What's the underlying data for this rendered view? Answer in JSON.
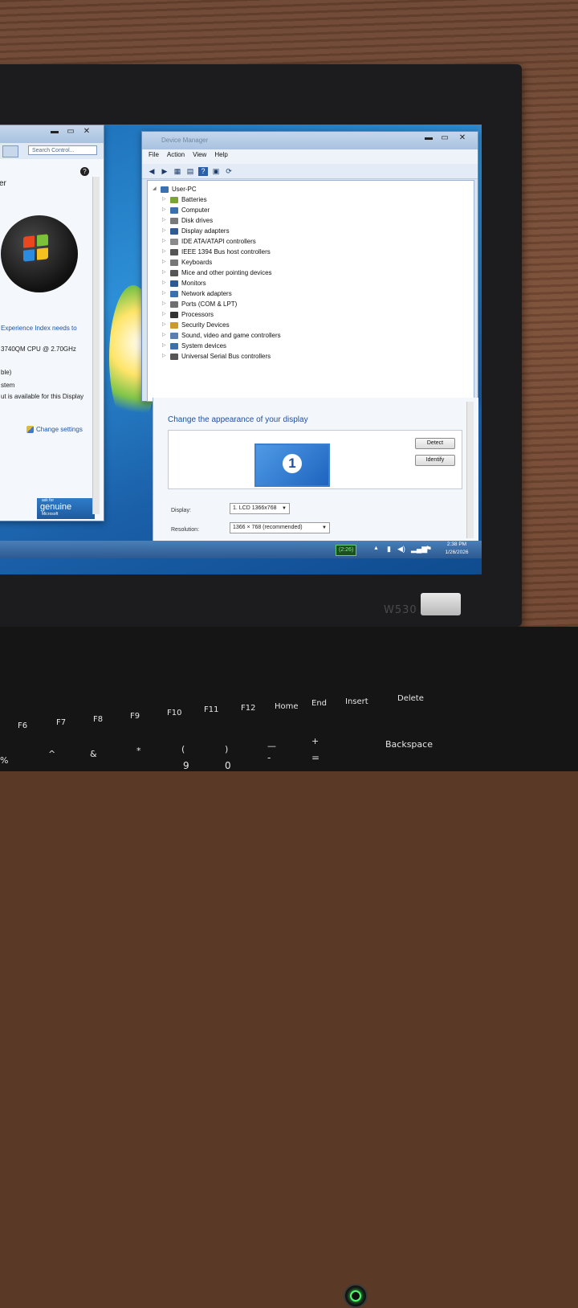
{
  "control_panel": {
    "search_placeholder": "Search Control...",
    "heading_partial": "er",
    "experience_text": "Experience Index needs to",
    "cpu_text": "3740QM CPU @ 2.70GHz",
    "line_able": "ble)",
    "line_stem": "stem",
    "display_note": "ut is available for this Display",
    "change_settings": "Change settings",
    "genuine_top": "ask for",
    "genuine": "genuine",
    "genuine_bottom": "Microsoft",
    "help_glyph": "?"
  },
  "device_manager": {
    "title": "Device Manager",
    "menu": [
      "File",
      "Action",
      "View",
      "Help"
    ],
    "root": "User-PC",
    "devices": [
      {
        "label": "Batteries",
        "icon": "battery-icon",
        "color": "#7aa33a"
      },
      {
        "label": "Computer",
        "icon": "computer-icon",
        "color": "#3a6fb0"
      },
      {
        "label": "Disk drives",
        "icon": "disk-icon",
        "color": "#7a7a7a"
      },
      {
        "label": "Display adapters",
        "icon": "display-adapter-icon",
        "color": "#2f5b95"
      },
      {
        "label": "IDE ATA/ATAPI controllers",
        "icon": "ide-icon",
        "color": "#8a8a8a"
      },
      {
        "label": "IEEE 1394 Bus host controllers",
        "icon": "firewire-icon",
        "color": "#555555"
      },
      {
        "label": "Keyboards",
        "icon": "keyboard-icon",
        "color": "#777777"
      },
      {
        "label": "Mice and other pointing devices",
        "icon": "mouse-icon",
        "color": "#555555"
      },
      {
        "label": "Monitors",
        "icon": "monitor-icon",
        "color": "#2f5b95"
      },
      {
        "label": "Network adapters",
        "icon": "network-icon",
        "color": "#3a6fb0"
      },
      {
        "label": "Ports (COM & LPT)",
        "icon": "port-icon",
        "color": "#6f6f6f"
      },
      {
        "label": "Processors",
        "icon": "processor-icon",
        "color": "#333333"
      },
      {
        "label": "Security Devices",
        "icon": "security-icon",
        "color": "#c99a2e"
      },
      {
        "label": "Sound, video and game controllers",
        "icon": "sound-icon",
        "color": "#5a7fb0"
      },
      {
        "label": "System devices",
        "icon": "system-icon",
        "color": "#3a6fb0"
      },
      {
        "label": "Universal Serial Bus controllers",
        "icon": "usb-icon",
        "color": "#555555"
      }
    ]
  },
  "display_settings": {
    "heading": "Change the appearance of your display",
    "detect": "Detect",
    "identify": "Identify",
    "monitor_number": "1",
    "display_label": "Display:",
    "display_value": "1. LCD 1366x768",
    "resolution_label": "Resolution:",
    "resolution_value": "1366 × 768 (recommended)"
  },
  "taskbar": {
    "battery_time": "(2:26)",
    "time": "2:38 PM",
    "date": "1/26/2026"
  },
  "laptop": {
    "brand": "W530",
    "keys_top": [
      "F6",
      "F7",
      "F8",
      "F9",
      "F10",
      "F11",
      "F12",
      "Home",
      "End",
      "Insert",
      "Delete"
    ],
    "keys_bottom": [
      "%",
      "^",
      "&",
      "*",
      "(",
      ")",
      "—",
      "+",
      "Backspace"
    ],
    "keys_digits": [
      "9",
      "0",
      "=",
      "-"
    ]
  }
}
